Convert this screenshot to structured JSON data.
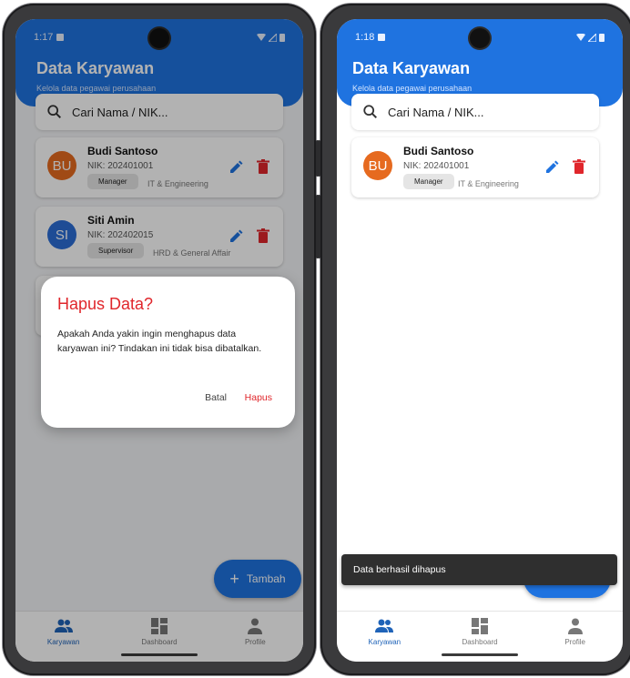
{
  "left": {
    "status": {
      "time": "1:17"
    },
    "header": {
      "title": "Data Karyawan",
      "subtitle": "Kelola data pegawai perusahaan"
    },
    "search": {
      "placeholder": "Cari Nama / NIK..."
    },
    "employees": [
      {
        "initials": "BU",
        "name": "Budi Santoso",
        "nik": "NIK: 202401001",
        "role": "Manager",
        "dept": "IT & Engineering",
        "color": "#e66a1f"
      },
      {
        "initials": "SI",
        "name": "Siti Amin",
        "nik": "NIK: 202402015",
        "role": "Supervisor",
        "dept": "HRD & General Affair",
        "color": "#2b6ed6"
      }
    ],
    "fab": {
      "label": "Tambah"
    },
    "dialog": {
      "title": "Hapus Data?",
      "body": "Apakah Anda yakin ingin menghapus data karyawan ini? Tindakan ini tidak bisa dibatalkan.",
      "cancel": "Batal",
      "confirm": "Hapus"
    },
    "nav": [
      {
        "label": "Karyawan",
        "icon": "people-icon",
        "active": true
      },
      {
        "label": "Dashboard",
        "icon": "dashboard-icon",
        "active": false
      },
      {
        "label": "Profile",
        "icon": "person-icon",
        "active": false
      }
    ]
  },
  "right": {
    "status": {
      "time": "1:18"
    },
    "header": {
      "title": "Data Karyawan",
      "subtitle": "Kelola data pegawai perusahaan"
    },
    "search": {
      "placeholder": "Cari Nama / NIK..."
    },
    "employees": [
      {
        "initials": "BU",
        "name": "Budi Santoso",
        "nik": "NIK: 202401001",
        "role": "Manager",
        "dept": "IT & Engineering",
        "color": "#e66a1f"
      }
    ],
    "snackbar": {
      "message": "Data berhasil dihapus"
    },
    "nav": [
      {
        "label": "Karyawan",
        "icon": "people-icon",
        "active": true
      },
      {
        "label": "Dashboard",
        "icon": "dashboard-icon",
        "active": false
      },
      {
        "label": "Profile",
        "icon": "person-icon",
        "active": false
      }
    ]
  },
  "colors": {
    "primary": "#1f73e0",
    "danger": "#e0262b",
    "navActive": "#1f63b8"
  }
}
